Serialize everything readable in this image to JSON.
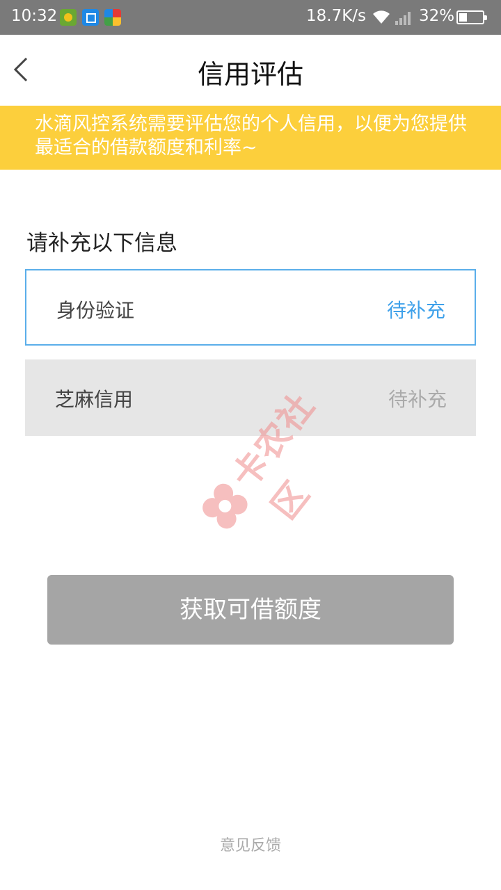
{
  "status_bar": {
    "time": "10:32",
    "net_speed": "18.7K/s",
    "battery": "32%"
  },
  "header": {
    "title": "信用评估",
    "back_icon": "chevron-left-icon"
  },
  "notice": {
    "text": "水滴风控系统需要评估您的个人信用，以便为您提供最适合的借款额度和利率~"
  },
  "section": {
    "title": "请补充以下信息",
    "items": [
      {
        "label": "身份验证",
        "status": "待补充"
      },
      {
        "label": "芝麻信用",
        "status": "待补充"
      }
    ]
  },
  "watermark": {
    "text": "卡农社区"
  },
  "action": {
    "label": "获取可借额度"
  },
  "footer": {
    "feedback": "意见反馈"
  },
  "colors": {
    "status_bar": "#7a7a7a",
    "notice_bg": "#fccf3c",
    "accent_blue": "#3fa1ea",
    "button_disabled": "#a5a5a5",
    "item_disabled_bg": "#e6e6e6"
  }
}
